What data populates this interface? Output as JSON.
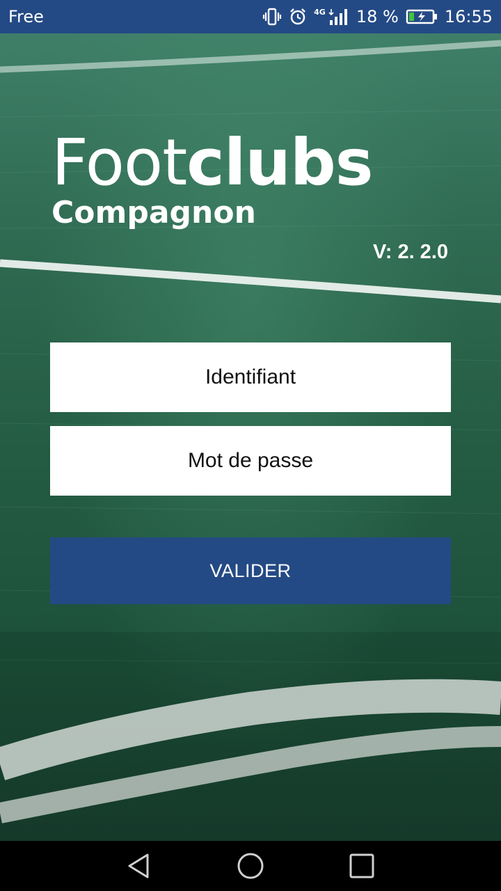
{
  "status_bar": {
    "carrier": "Free",
    "network": "4G",
    "battery_percent": "18 %",
    "time": "16:55",
    "icons": [
      "vibrate-icon",
      "alarm-icon",
      "signal-icon",
      "battery-charging-icon"
    ]
  },
  "logo": {
    "title_light": "Foot",
    "title_bold": "clubs",
    "subtitle": "Compagnon"
  },
  "version": "V: 2. 2.0",
  "form": {
    "login_placeholder": "Identifiant",
    "password_placeholder": "Mot de passe",
    "submit_label": "VALIDER"
  },
  "nav": {
    "icons": [
      "back-icon",
      "home-icon",
      "recents-icon"
    ]
  },
  "colors": {
    "accent": "#244a85",
    "field_green": "#245d43"
  }
}
